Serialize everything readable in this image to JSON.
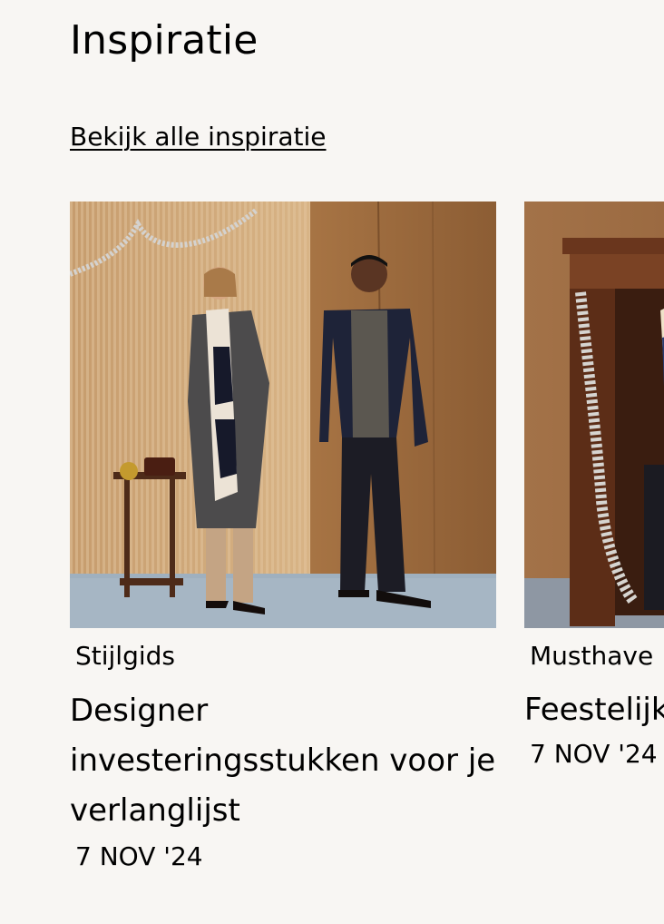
{
  "section": {
    "title": "Inspiratie",
    "view_all_label": "Bekijk alle inspiratie"
  },
  "cards": [
    {
      "category": "Stijlgids",
      "title": "Designer investeringsstukken voor je verlanglijst",
      "date": "7 NOV '24",
      "image_alt": "Two models in winter outfits in front of a wood-panelled wall with tinsel"
    },
    {
      "category": "Musthave",
      "title": "Feestelijk",
      "date": "7 NOV '24",
      "image_alt": "Model beside a wooden cabinet decorated with tinsel"
    }
  ]
}
